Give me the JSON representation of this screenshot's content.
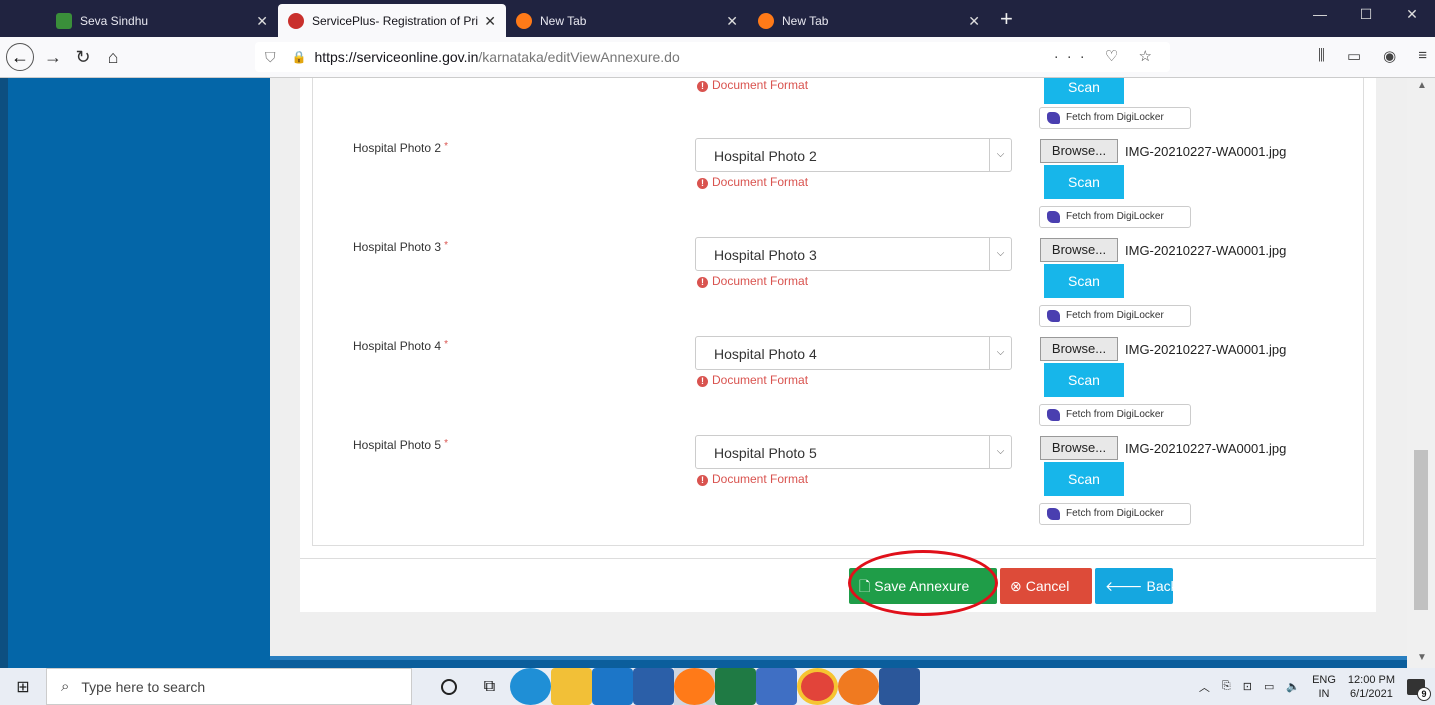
{
  "browser": {
    "tabs": [
      {
        "title": "Seva Sindhu",
        "color": "#3a8f3a",
        "active": false
      },
      {
        "title": "ServicePlus- Registration of Pri",
        "color": "#c9302c",
        "active": true
      },
      {
        "title": "New Tab",
        "color": "#ff7a18",
        "active": false
      },
      {
        "title": "New Tab",
        "color": "#ff7a18",
        "active": false
      }
    ],
    "url_host": "https://serviceonline.gov.in",
    "url_path": "/karnataka/editViewAnnexure.do"
  },
  "top_row": {
    "doc_format": "Document Format",
    "scan": "Scan",
    "digilocker": "Fetch from DigiLocker"
  },
  "rows": [
    {
      "label": "Hospital Photo 2",
      "select_value": "Hospital Photo 2",
      "doc_format": "Document Format",
      "browse": "Browse...",
      "filename": "IMG-20210227-WA0001.jpg",
      "scan": "Scan",
      "digilocker": "Fetch from DigiLocker"
    },
    {
      "label": "Hospital Photo 3",
      "select_value": "Hospital Photo 3",
      "doc_format": "Document Format",
      "browse": "Browse...",
      "filename": "IMG-20210227-WA0001.jpg",
      "scan": "Scan",
      "digilocker": "Fetch from DigiLocker"
    },
    {
      "label": "Hospital Photo 4",
      "select_value": "Hospital Photo 4",
      "doc_format": "Document Format",
      "browse": "Browse...",
      "filename": "IMG-20210227-WA0001.jpg",
      "scan": "Scan",
      "digilocker": "Fetch from DigiLocker"
    },
    {
      "label": "Hospital Photo 5",
      "select_value": "Hospital Photo 5",
      "doc_format": "Document Format",
      "browse": "Browse...",
      "filename": "IMG-20210227-WA0001.jpg",
      "scan": "Scan",
      "digilocker": "Fetch from DigiLocker"
    }
  ],
  "actions": {
    "save": "Save Annexure",
    "cancel": "Cancel",
    "back": "Back"
  },
  "taskbar": {
    "search_placeholder": "Type here to search",
    "lang_top": "ENG",
    "lang_bottom": "IN",
    "time": "12:00 PM",
    "date": "6/1/2021",
    "notif_count": "9"
  }
}
